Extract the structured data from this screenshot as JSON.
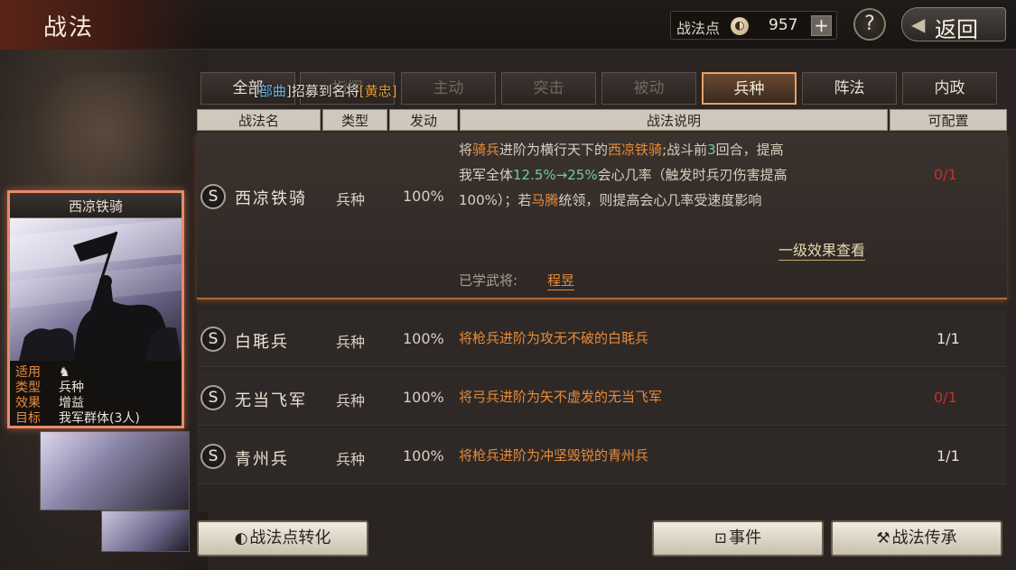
{
  "header": {
    "title": "战法",
    "points_label": "战法点",
    "points_value": "957",
    "plus_label": "+",
    "help_label": "?",
    "back_label": "返回"
  },
  "banner": {
    "prefix": "全部",
    "tag_open": "[",
    "tag_blue": "部曲",
    "tag_close": "]",
    "middle": "招募到名将",
    "hero_tag": "[黄忠]"
  },
  "tabs": [
    {
      "label": "全部"
    },
    {
      "label": "指挥"
    },
    {
      "label": "主动"
    },
    {
      "label": "突击"
    },
    {
      "label": "被动"
    },
    {
      "label": "兵种"
    },
    {
      "label": "阵法"
    },
    {
      "label": "内政"
    }
  ],
  "active_tab": "兵种",
  "columns": {
    "name": "战法名",
    "type": "类型",
    "rate": "发动",
    "desc": "战法说明",
    "config": "可配置"
  },
  "expanded": {
    "icon": "S",
    "name": "西凉铁骑",
    "type": "兵种",
    "rate": "100%",
    "desc_parts": {
      "p1": "将",
      "p2": "骑兵",
      "p3": "进阶为横行天下的",
      "p4": "西凉铁骑",
      "p5": ";战斗前",
      "p6": "3",
      "p7": "回合，提高",
      "p8": "我军全体",
      "p9": "12.5%→25%",
      "p10": "会心几率（触发时兵刃伤害提高",
      "p11": "100%）；若",
      "p12": "马腾",
      "p13": "统领，则提高会心几率受速度影响"
    },
    "config": "0/1",
    "effect_link": "一级效果查看",
    "learned_label": "已学武将:",
    "learned_name": "程昱"
  },
  "rows": [
    {
      "icon": "S",
      "name": "白毦兵",
      "type": "兵种",
      "rate": "100%",
      "d1": "将",
      "d2": "枪兵",
      "d3": "进阶为攻无不破的",
      "d4": "白毦兵",
      "config": "1/1",
      "config_red": false
    },
    {
      "icon": "S",
      "name": "无当飞军",
      "type": "兵种",
      "rate": "100%",
      "d1": "将",
      "d2": "弓兵",
      "d3": "进阶为矢不虚发的",
      "d4": "无当飞军",
      "config": "0/1",
      "config_red": true
    },
    {
      "icon": "S",
      "name": "青州兵",
      "type": "兵种",
      "rate": "100%",
      "d1": "将",
      "d2": "枪兵",
      "d3": "进阶为冲坚毁锐的",
      "d4": "青州兵",
      "config": "1/1",
      "config_red": false
    }
  ],
  "card": {
    "title": "西凉铁骑",
    "info": [
      {
        "key": "适用",
        "value": ""
      },
      {
        "key": "类型",
        "value": "兵种"
      },
      {
        "key": "效果",
        "value": "增益"
      },
      {
        "key": "目标",
        "value": "我军群体(3人)"
      }
    ]
  },
  "buttons": {
    "convert": "战法点转化",
    "event": "事件",
    "inherit": "战法传承"
  },
  "colors": {
    "accent_orange": "#e88a3a",
    "accent_green": "#6fce9a",
    "warn_red": "#c8302a",
    "active_tab_border": "#e8a060"
  }
}
